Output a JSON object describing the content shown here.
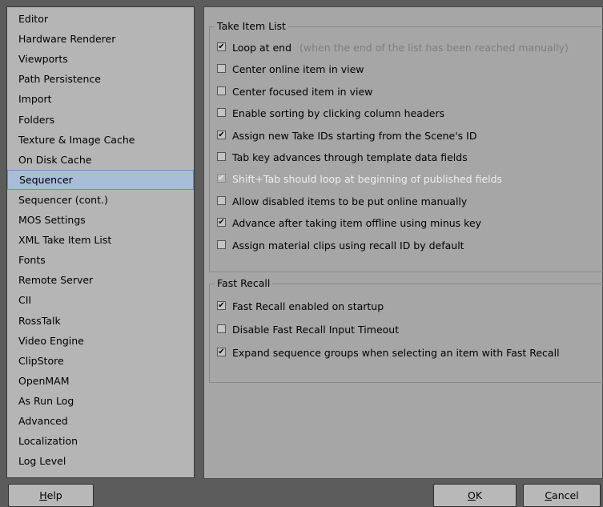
{
  "sidebar": {
    "items": [
      {
        "label": "Editor",
        "selected": false
      },
      {
        "label": "Hardware Renderer",
        "selected": false
      },
      {
        "label": "Viewports",
        "selected": false
      },
      {
        "label": "Path Persistence",
        "selected": false
      },
      {
        "label": "Import",
        "selected": false
      },
      {
        "label": "Folders",
        "selected": false
      },
      {
        "label": "Texture & Image Cache",
        "selected": false
      },
      {
        "label": "On Disk Cache",
        "selected": false
      },
      {
        "label": "Sequencer",
        "selected": true
      },
      {
        "label": "Sequencer (cont.)",
        "selected": false
      },
      {
        "label": "MOS Settings",
        "selected": false
      },
      {
        "label": "XML Take Item List",
        "selected": false
      },
      {
        "label": "Fonts",
        "selected": false
      },
      {
        "label": "Remote Server",
        "selected": false
      },
      {
        "label": "CII",
        "selected": false
      },
      {
        "label": "RossTalk",
        "selected": false
      },
      {
        "label": "Video Engine",
        "selected": false
      },
      {
        "label": "ClipStore",
        "selected": false
      },
      {
        "label": "OpenMAM",
        "selected": false
      },
      {
        "label": "As Run Log",
        "selected": false
      },
      {
        "label": "Advanced",
        "selected": false
      },
      {
        "label": "Localization",
        "selected": false
      },
      {
        "label": "Log Level",
        "selected": false
      }
    ]
  },
  "take_item_list": {
    "title": "Take Item List",
    "options": [
      {
        "label": "Loop at end",
        "checked": true,
        "disabled": false,
        "hint": "(when the end of the list has been reached manually)"
      },
      {
        "label": "Center online item in view",
        "checked": false,
        "disabled": false,
        "hint": ""
      },
      {
        "label": "Center focused item in view",
        "checked": false,
        "disabled": false,
        "hint": ""
      },
      {
        "label": "Enable sorting by clicking column headers",
        "checked": false,
        "disabled": false,
        "hint": ""
      },
      {
        "label": "Assign new Take IDs starting from the Scene's ID",
        "checked": true,
        "disabled": false,
        "hint": ""
      },
      {
        "label": "Tab key advances through template data fields",
        "checked": false,
        "disabled": false,
        "hint": ""
      },
      {
        "label": "Shift+Tab should loop at beginning of published fields",
        "checked": true,
        "disabled": true,
        "hint": ""
      },
      {
        "label": "Allow disabled items to be put online manually",
        "checked": false,
        "disabled": false,
        "hint": ""
      },
      {
        "label": "Advance after taking item offline using minus key",
        "checked": true,
        "disabled": false,
        "hint": ""
      },
      {
        "label": "Assign material clips using recall ID by default",
        "checked": false,
        "disabled": false,
        "hint": ""
      }
    ]
  },
  "fast_recall": {
    "title": "Fast Recall",
    "options": [
      {
        "label": "Fast Recall enabled on startup",
        "checked": true,
        "disabled": false,
        "hint": ""
      },
      {
        "label": "Disable Fast Recall Input Timeout",
        "checked": false,
        "disabled": false,
        "hint": ""
      },
      {
        "label": "Expand sequence groups when selecting an item with Fast Recall",
        "checked": true,
        "disabled": false,
        "hint": ""
      }
    ]
  },
  "buttons": {
    "help": {
      "first": "H",
      "rest": "elp"
    },
    "ok": {
      "first": "O",
      "rest": "K"
    },
    "cancel": {
      "first": "C",
      "rest": "ancel"
    }
  },
  "check_glyph": "✔"
}
